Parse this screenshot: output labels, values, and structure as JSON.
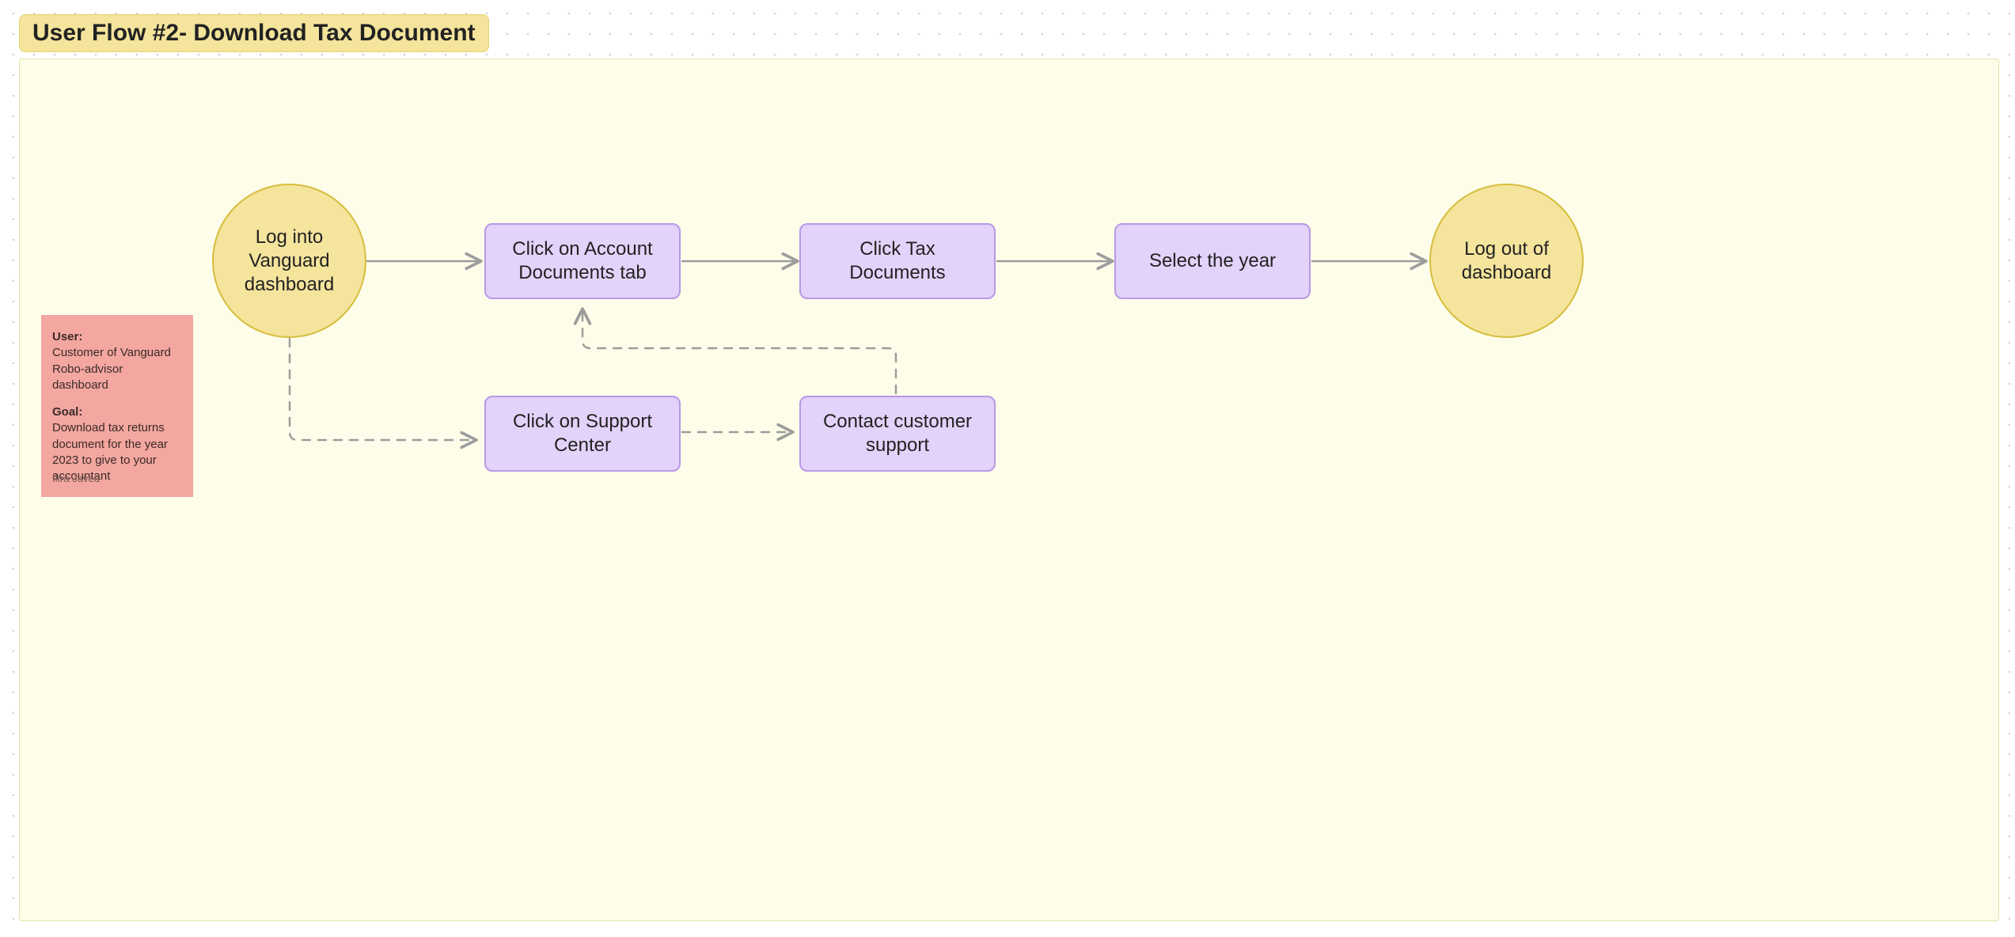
{
  "frame": {
    "title": "User Flow #2-  Download Tax Document"
  },
  "nodes": {
    "start": {
      "label": "Log into Vanguard dashboard"
    },
    "step1": {
      "label": "Click on Account Documents tab"
    },
    "step2": {
      "label": "Click Tax Documents"
    },
    "step3": {
      "label": "Select the year"
    },
    "end": {
      "label": "Log out of dashboard"
    },
    "alt1": {
      "label": "Click on Support Center"
    },
    "alt2": {
      "label": "Contact customer support"
    }
  },
  "sticky": {
    "user_label": "User:",
    "user_text": "Customer of Vanguard Robo-advisor dashboard",
    "goal_label": "Goal:",
    "goal_text": "Download tax returns document for the year 2023 to give to your accountant",
    "author": "Ikra Javed"
  },
  "colors": {
    "frame_bg": "#fdfde9",
    "title_bg": "#f4e49c",
    "circle_bg": "#f4e49c",
    "circle_border": "#d7bd3d",
    "rect_bg": "#e3d2f9",
    "rect_border": "#b998e6",
    "sticky_bg": "#f3a7a0",
    "arrow": "#9d9d9d"
  },
  "edges": [
    {
      "from": "start",
      "to": "step1",
      "style": "solid"
    },
    {
      "from": "step1",
      "to": "step2",
      "style": "solid"
    },
    {
      "from": "step2",
      "to": "step3",
      "style": "solid"
    },
    {
      "from": "step3",
      "to": "end",
      "style": "solid"
    },
    {
      "from": "start",
      "to": "alt1",
      "style": "dashed"
    },
    {
      "from": "alt1",
      "to": "alt2",
      "style": "dashed"
    },
    {
      "from": "alt2",
      "to": "step1",
      "style": "dashed"
    }
  ]
}
